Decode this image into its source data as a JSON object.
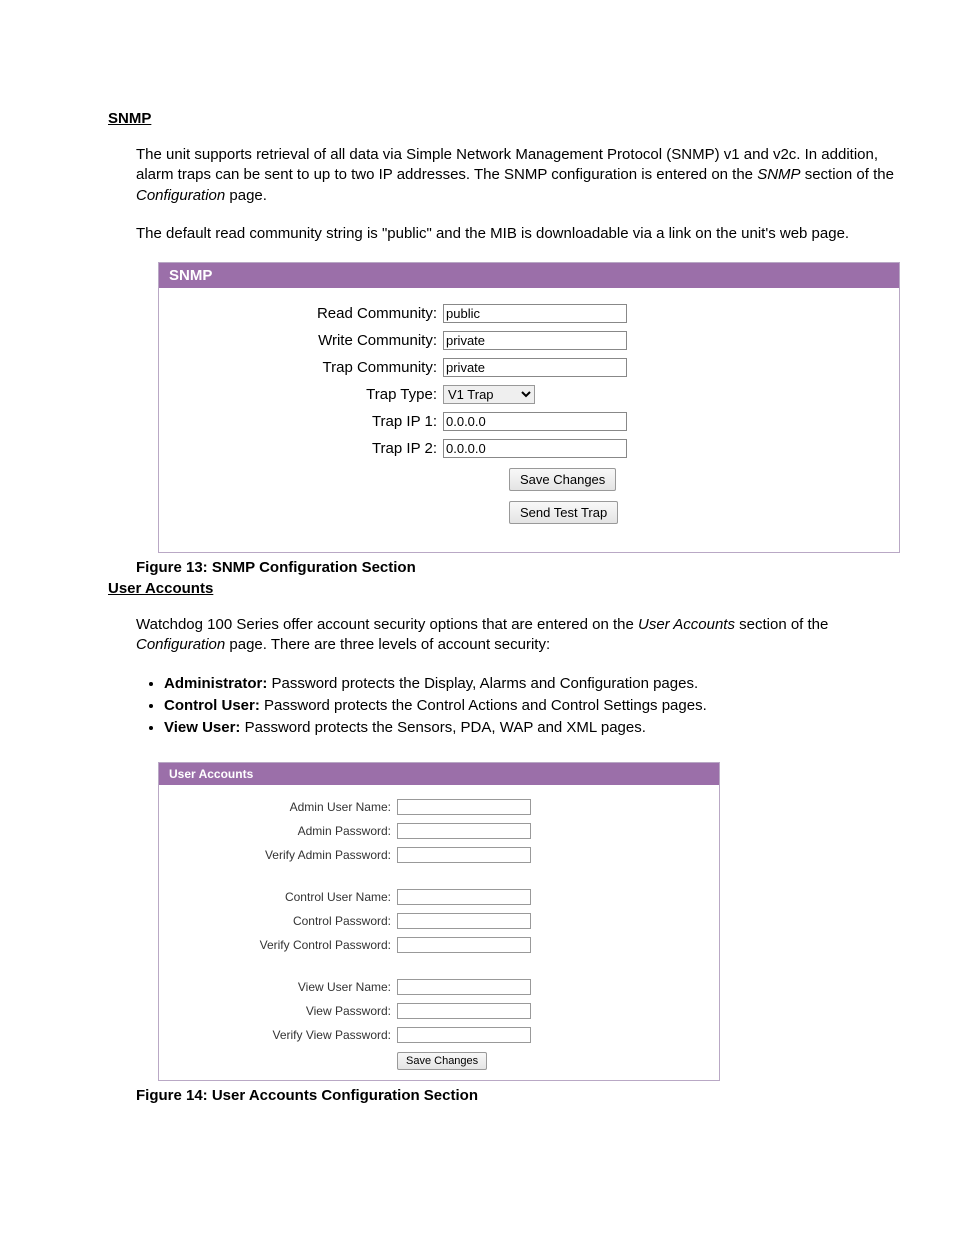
{
  "snmp": {
    "heading": "SNMP",
    "para1a": "The unit supports retrieval of all data via Simple Network Management Protocol (SNMP) v1 and v2c.  In addition, alarm traps can be sent to up to two IP addresses.  The SNMP configuration is entered on the ",
    "para1_snmp": "SNMP",
    "para1b": " section of the ",
    "para1_config": "Configuration",
    "para1c": " page.",
    "para2": "The default read community string is \"public\" and the MIB is downloadable via a link on the unit's web page.",
    "panel_title": "SNMP",
    "labels": {
      "read": "Read Community:",
      "write": "Write Community:",
      "trap_comm": "Trap Community:",
      "trap_type": "Trap Type:",
      "trap_ip1": "Trap IP 1:",
      "trap_ip2": "Trap IP 2:"
    },
    "values": {
      "read": "public",
      "write": "private",
      "trap_comm": "private",
      "trap_type": "V1 Trap",
      "trap_ip1": "0.0.0.0",
      "trap_ip2": "0.0.0.0"
    },
    "buttons": {
      "save": "Save Changes",
      "send_trap": "Send Test Trap"
    },
    "figure": "Figure 13: SNMP Configuration Section"
  },
  "users": {
    "heading": "User Accounts",
    "para_a": "Watchdog 100 Series offer account security options that are entered on the ",
    "para_ua": "User Accounts",
    "para_b": " section of the ",
    "para_config": "Configuration",
    "para_c": " page.  There are three levels of account security:",
    "bullets": [
      {
        "bold": "Administrator:",
        "rest": " Password protects the Display, Alarms and Configuration pages."
      },
      {
        "bold": "Control User:",
        "rest": " Password protects the Control Actions and Control Settings pages."
      },
      {
        "bold": "View User:",
        "rest": " Password protects the Sensors, PDA, WAP and XML pages."
      }
    ],
    "panel_title": "User Accounts",
    "labels": {
      "admin_name": "Admin User Name:",
      "admin_pw": "Admin Password:",
      "admin_vpw": "Verify Admin Password:",
      "ctrl_name": "Control User Name:",
      "ctrl_pw": "Control Password:",
      "ctrl_vpw": "Verify Control Password:",
      "view_name": "View User Name:",
      "view_pw": "View Password:",
      "view_vpw": "Verify View Password:"
    },
    "save": "Save Changes",
    "figure": "Figure 14: User Accounts Configuration Section"
  }
}
